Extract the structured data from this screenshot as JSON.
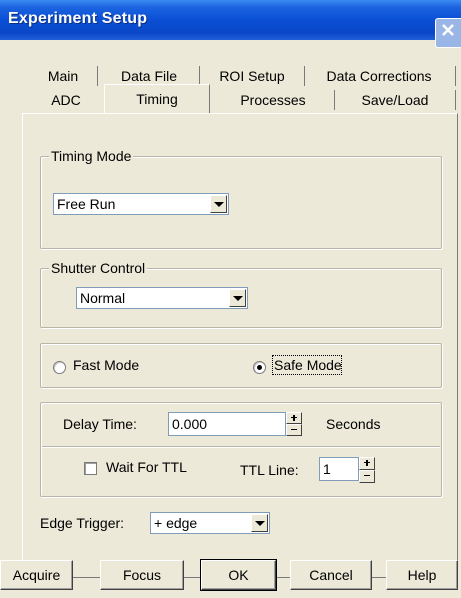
{
  "window": {
    "title": "Experiment Setup"
  },
  "tabs": {
    "row1": [
      "Main",
      "Data File",
      "ROI Setup",
      "Data Corrections"
    ],
    "row2": [
      "ADC",
      "Timing",
      "Processes",
      "Save/Load"
    ],
    "active": "Timing"
  },
  "timing_mode": {
    "legend": "Timing Mode",
    "value": "Free Run"
  },
  "shutter_control": {
    "legend": "Shutter Control",
    "value": "Normal"
  },
  "mode": {
    "fast_label": "Fast Mode",
    "safe_label": "Safe Mode",
    "selected": "Safe Mode"
  },
  "delay": {
    "label": "Delay Time:",
    "value": "0.000",
    "unit": "Seconds"
  },
  "ttl": {
    "wait_label": "Wait For TTL",
    "wait_checked": false,
    "line_label": "TTL Line:",
    "line_value": "1"
  },
  "edge_trigger": {
    "label": "Edge Trigger:",
    "value": "+ edge"
  },
  "buttons": {
    "acquire": "Acquire",
    "focus": "Focus",
    "ok": "OK",
    "cancel": "Cancel",
    "help": "Help"
  },
  "icons": {
    "close": "close-icon",
    "dropdown": "chevron-down-icon"
  }
}
